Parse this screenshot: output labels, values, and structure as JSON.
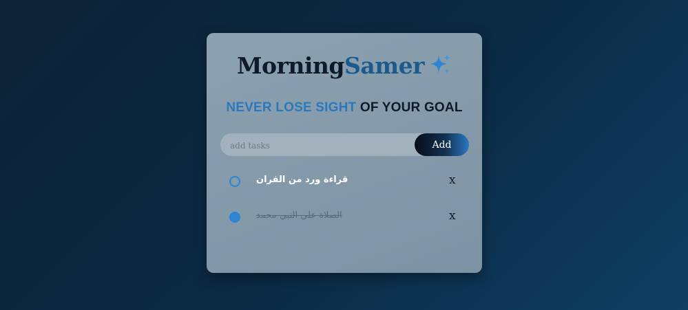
{
  "app": {
    "title_part1": "Morning",
    "title_part2": "Samer",
    "title_icon": "sparkle-icon",
    "tagline_part1": "NEVER LOSE SIGHT",
    "tagline_part2": " OF YOUR GOAL"
  },
  "input": {
    "placeholder": "add tasks",
    "value": "",
    "add_label": "Add"
  },
  "tasks": [
    {
      "text": "قراءة ورد من القران",
      "done": false,
      "remove_label": "x"
    },
    {
      "text": "الصلاة علي النبي محمد",
      "done": true,
      "remove_label": "x"
    }
  ],
  "colors": {
    "accent": "#2a86d0",
    "title_dark": "#0d1a2a",
    "title_blue": "#1c5a8c"
  }
}
